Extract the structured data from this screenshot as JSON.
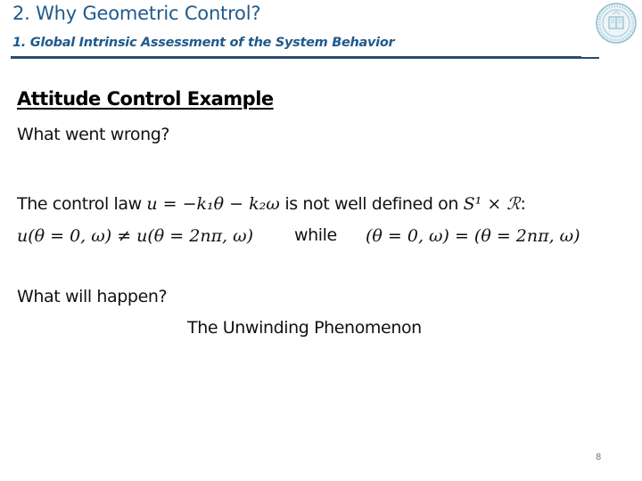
{
  "header": {
    "title": "2. Why Geometric Control?",
    "subtitle": "1. Global Intrinsic Assessment of the System Behavior",
    "accent_color": "#1f5a8c",
    "rule_color": "#2b4a6e",
    "logo": "university-seal-icon"
  },
  "content": {
    "heading": "Attitude Control Example",
    "question1": "What went wrong?",
    "line1": {
      "prefix": "The control law ",
      "equation": "u = −k₁θ − k₂ω",
      "middle": " is not well defined on ",
      "space": "S¹ × ℛ",
      "suffix": ":"
    },
    "line2": {
      "inequality": "u(θ = 0, ω) ≠ u(θ = 2nπ, ω)",
      "connector": "while",
      "equality": "(θ = 0, ω) = (θ = 2nπ, ω)"
    },
    "question2": "What will happen?",
    "answer": "The Unwinding Phenomenon"
  },
  "footer": {
    "page_number": "8"
  }
}
